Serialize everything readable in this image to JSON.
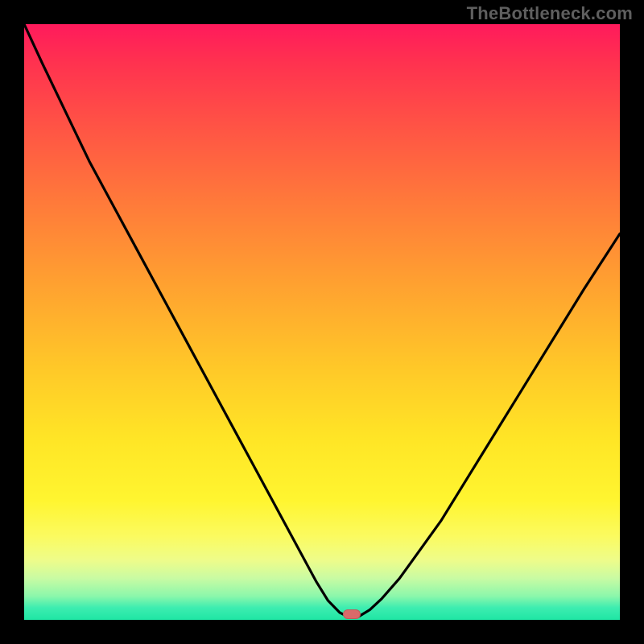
{
  "watermark": "TheBottleneck.com",
  "chart_data": {
    "type": "line",
    "title": "",
    "xlabel": "",
    "ylabel": "",
    "xlim": [
      0,
      100
    ],
    "ylim": [
      0,
      108
    ],
    "x": [
      0,
      3,
      7,
      11,
      15,
      19,
      23,
      27,
      31,
      35,
      38,
      41,
      44,
      47,
      49,
      51,
      53,
      54.5,
      56,
      58,
      60,
      63,
      66,
      70,
      74,
      78,
      82,
      86,
      90,
      94,
      97,
      100
    ],
    "values": [
      108,
      101,
      92,
      83,
      75,
      67,
      59,
      51,
      43,
      35,
      29,
      23,
      17,
      11,
      7,
      3.5,
      1.3,
      0.5,
      0.5,
      1.8,
      3.8,
      7.5,
      12,
      18,
      25,
      32,
      39,
      46,
      53,
      60,
      65,
      70
    ],
    "marker": {
      "x": 55,
      "y": 0.5
    },
    "background_gradient": {
      "stops": [
        {
          "t": 0.0,
          "color": "#ff1a5c"
        },
        {
          "t": 0.5,
          "color": "#ffc020"
        },
        {
          "t": 0.8,
          "color": "#fff530"
        },
        {
          "t": 1.0,
          "color": "#1fe6a4"
        }
      ]
    }
  }
}
